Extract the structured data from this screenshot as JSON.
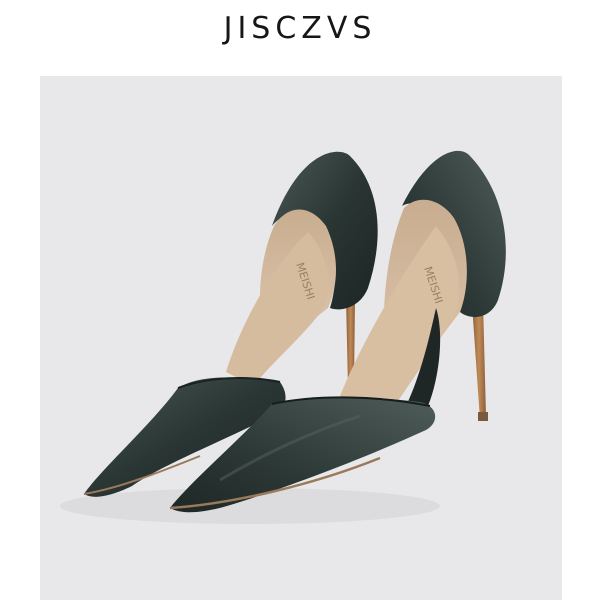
{
  "header": {
    "brand": "JISCZVS"
  },
  "product_photo": {
    "insole_logo_left": "MEISHI",
    "insole_logo_right": "MEISHI",
    "colors": {
      "background": "#e8e8ea",
      "satin": "#2a3634",
      "satin_highlight": "#4a5856",
      "lining": "#d3b79b",
      "lining_shadow": "#b59a7c",
      "heel": "#b07a4a",
      "sole_edge": "#9a7a5a"
    }
  }
}
